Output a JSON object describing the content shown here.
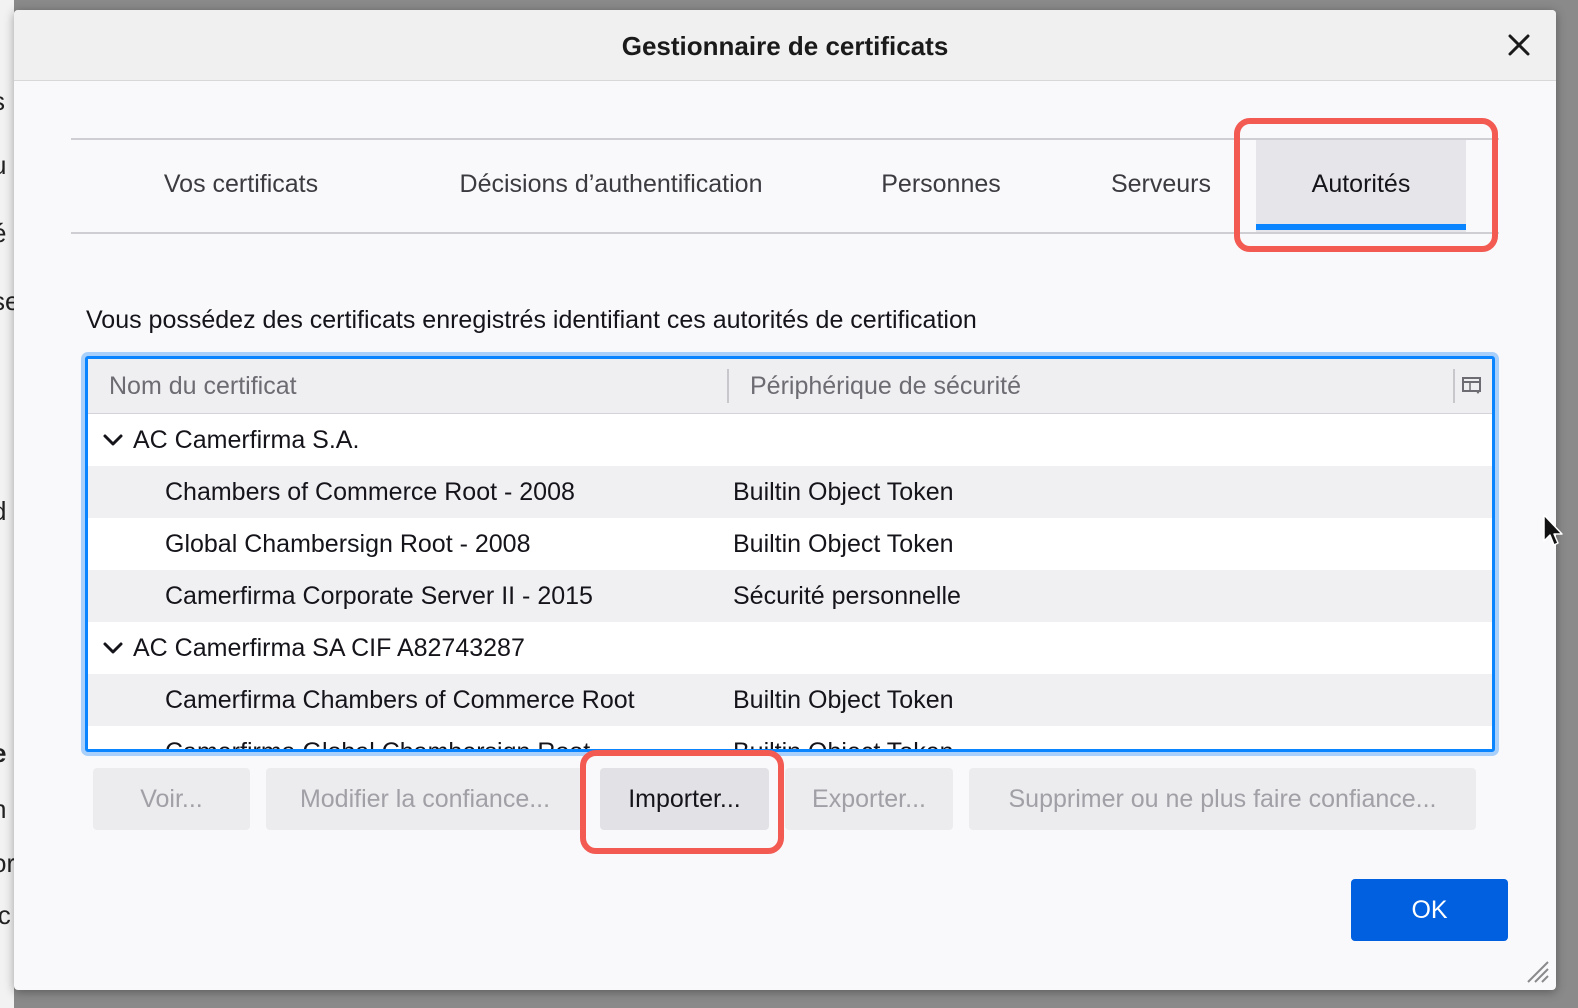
{
  "background_letters": [
    "s",
    "u",
    "é",
    "se",
    "d",
    "e",
    "n",
    "or",
    "ic"
  ],
  "dialog": {
    "title": "Gestionnaire de certificats",
    "close_icon": "close-icon"
  },
  "tabs": [
    {
      "label": "Vos certificats",
      "active": false
    },
    {
      "label": "Décisions d’authentification",
      "active": false
    },
    {
      "label": "Personnes",
      "active": false
    },
    {
      "label": "Serveurs",
      "active": false
    },
    {
      "label": "Autorités",
      "active": true
    }
  ],
  "description": "Vous possédez des certificats enregistrés identifiant ces autorités de certification",
  "tree": {
    "columns": [
      "Nom du certificat",
      "Périphérique de sécurité"
    ],
    "column_picker_icon": "column-picker-icon",
    "rows": [
      {
        "type": "group",
        "name": "AC Camerfirma S.A.",
        "device": ""
      },
      {
        "type": "cert",
        "name": "Chambers of Commerce Root - 2008",
        "device": "Builtin Object Token"
      },
      {
        "type": "cert",
        "name": "Global Chambersign Root - 2008",
        "device": "Builtin Object Token"
      },
      {
        "type": "cert",
        "name": "Camerfirma Corporate Server II - 2015",
        "device": "Sécurité personnelle"
      },
      {
        "type": "group",
        "name": "AC Camerfirma SA CIF A82743287",
        "device": ""
      },
      {
        "type": "cert",
        "name": "Camerfirma Chambers of Commerce Root",
        "device": "Builtin Object Token"
      },
      {
        "type": "cert",
        "name": "Camerfirma Global Chambersign Root",
        "device": "Builtin Object Token"
      }
    ]
  },
  "actions": {
    "view": "Voir...",
    "edit_trust": "Modifier la confiance...",
    "import": "Importer...",
    "export": "Exporter...",
    "delete": "Supprimer ou ne plus faire confiance..."
  },
  "ok_label": "OK",
  "colors": {
    "accent": "#0a84ff",
    "primary_button": "#0060df",
    "highlight": "#f25a52"
  }
}
